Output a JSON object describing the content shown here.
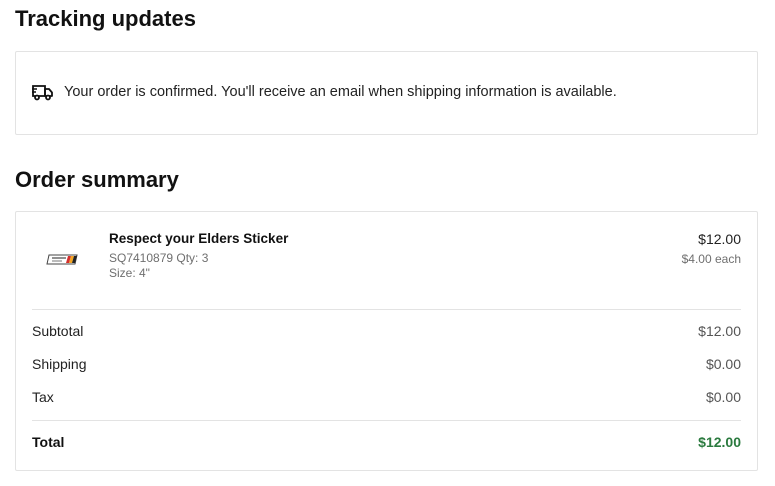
{
  "tracking": {
    "title": "Tracking updates",
    "message": "Your order is confirmed. You'll receive an email when shipping information is available.",
    "icon": "truck-icon"
  },
  "summary": {
    "title": "Order summary",
    "item": {
      "name": "Respect your Elders Sticker",
      "sku_qty": "SQ7410879 Qty: 3",
      "size": "Size: 4\"",
      "price": "$12.00",
      "each": "$4.00 each"
    },
    "rows": [
      {
        "label": "Subtotal",
        "value": "$12.00"
      },
      {
        "label": "Shipping",
        "value": "$0.00"
      },
      {
        "label": "Tax",
        "value": "$0.00"
      }
    ],
    "total": {
      "label": "Total",
      "value": "$12.00"
    },
    "accent_color": "#2a7a3e"
  }
}
